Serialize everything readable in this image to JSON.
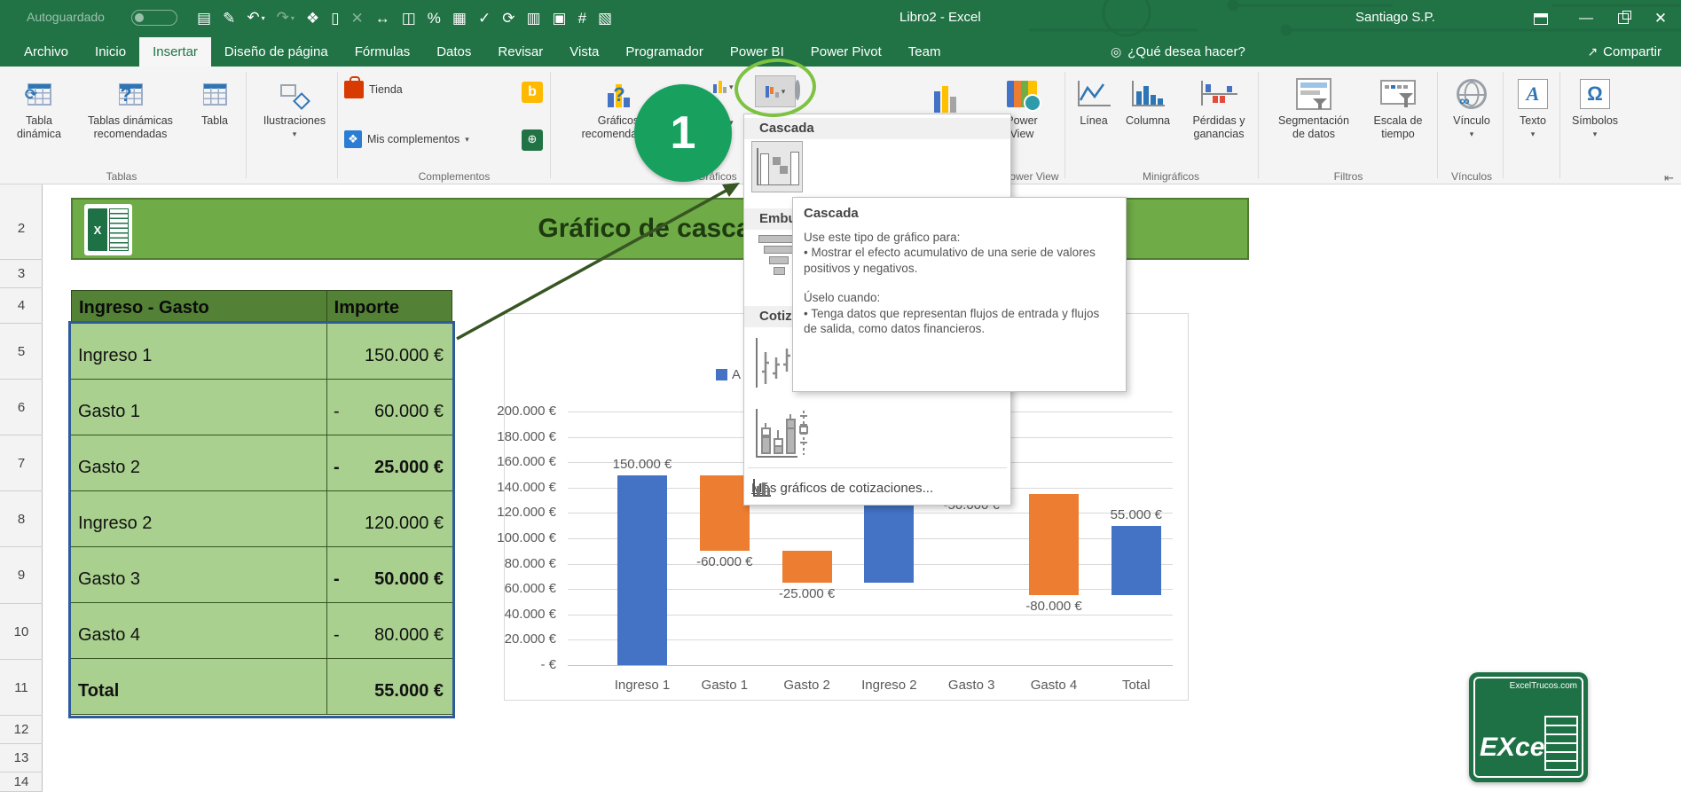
{
  "colors": {
    "excel_green": "#217346",
    "banner_green": "#6FAC47",
    "header_green": "#538135",
    "cell_green": "#A9D08E",
    "cell_border": "#375623",
    "selection_blue": "#2E5B9C",
    "bar_blue": "#4472C4",
    "bar_orange": "#ED7D31",
    "annotation_green": "#18A05E",
    "ring_green": "#7DC242",
    "arrow_green": "#375623"
  },
  "titlebar": {
    "autosave_label": "Autoguardado",
    "autosave_state": "off",
    "qat_icons": [
      {
        "glyph": "▤",
        "name": "new-file-icon"
      },
      {
        "glyph": "✎",
        "name": "save-icon"
      },
      {
        "glyph": "↶",
        "name": "undo-icon",
        "arrow": true
      },
      {
        "glyph": "↷",
        "name": "redo-icon",
        "arrow": true,
        "dim": true
      },
      {
        "glyph": "❖",
        "name": "format-painter-icon"
      },
      {
        "glyph": "▯",
        "name": "new-document-icon"
      },
      {
        "glyph": "✕",
        "name": "clear-filter-icon",
        "dim": true
      },
      {
        "glyph": "↔",
        "name": "resize-window-icon"
      },
      {
        "glyph": "◫",
        "name": "print-preview-icon"
      },
      {
        "glyph": "%",
        "name": "percent-style-icon"
      },
      {
        "glyph": "▦",
        "name": "print-icon"
      },
      {
        "glyph": "✓",
        "name": "spelling-icon"
      },
      {
        "glyph": "⟳",
        "name": "refresh-icon"
      },
      {
        "glyph": "▥",
        "name": "calculate-sheet-icon"
      },
      {
        "glyph": "▣",
        "name": "form-icon"
      },
      {
        "glyph": "#",
        "name": "number-format-icon"
      },
      {
        "glyph": "▧",
        "name": "paste-special-icon"
      }
    ],
    "document_title": "Libro2 - Excel",
    "user_name": "Santiago S.P."
  },
  "ribbon_tabs": {
    "items": [
      {
        "label": "Archivo",
        "name": "tab-archivo"
      },
      {
        "label": "Inicio",
        "name": "tab-inicio"
      },
      {
        "label": "Insertar",
        "name": "tab-insertar",
        "active": true
      },
      {
        "label": "Diseño de página",
        "name": "tab-diseno"
      },
      {
        "label": "Fórmulas",
        "name": "tab-formulas"
      },
      {
        "label": "Datos",
        "name": "tab-datos"
      },
      {
        "label": "Revisar",
        "name": "tab-revisar"
      },
      {
        "label": "Vista",
        "name": "tab-vista"
      },
      {
        "label": "Programador",
        "name": "tab-programador"
      },
      {
        "label": "Power BI",
        "name": "tab-power-bi"
      },
      {
        "label": "Power Pivot",
        "name": "tab-power-pivot"
      },
      {
        "label": "Team",
        "name": "tab-team"
      }
    ],
    "search_label": "¿Qué desea hacer?",
    "share_label": "Compartir"
  },
  "ribbon": {
    "tablas": {
      "group_label": "Tablas",
      "b1l1": "Tabla",
      "b1l2": "dinámica",
      "b2l1": "Tablas dinámicas",
      "b2l2": "recomendadas",
      "b3": "Tabla"
    },
    "ilustraciones": {
      "label": "Ilustraciones"
    },
    "complementos": {
      "group_label": "Complementos",
      "tienda": "Tienda",
      "mis": "Mis complementos"
    },
    "graficos": {
      "group_label": "Gráficos",
      "recl1": "Gráficos",
      "recl2": "recomendados"
    },
    "power_view": {
      "group_label": "Power View",
      "l1": "Power",
      "l2": "View"
    },
    "minigraficos": {
      "group_label": "Minigráficos",
      "linea": "Línea",
      "columna": "Columna",
      "perdidasl1": "Pérdidas y",
      "perdidasl2": "ganancias"
    },
    "filtros": {
      "group_label": "Filtros",
      "segl1": "Segmentación",
      "segl2": "de datos",
      "escl1": "Escala de",
      "escl2": "tiempo"
    },
    "vinculos": {
      "group_label": "Vínculos",
      "vinculo": "Vínculo"
    },
    "texto": {
      "label": "Texto"
    },
    "simbolos": {
      "label": "Símbolos"
    }
  },
  "dropdown_menu": {
    "sections": [
      {
        "header": "Cascada"
      },
      {
        "header": "Embudo"
      },
      {
        "header": "Cotizaciones"
      }
    ],
    "footer_accel": "M",
    "footer_rest": "ás gráficos de cotizaciones..."
  },
  "tooltip": {
    "title": "Cascada",
    "intro": "Use este tipo de gráfico para:",
    "bullet1": "• Mostrar el efecto acumulativo de una serie de valores positivos y negativos.",
    "when_title": "Úselo cuando:",
    "bullet2": "• Tenga datos que representan flujos de entrada y flujos de salida, como datos financieros."
  },
  "annotation": {
    "step_number": "1"
  },
  "sheet": {
    "row_numbers": [
      "2",
      "3",
      "4",
      "5",
      "6",
      "7",
      "8",
      "9",
      "10",
      "11",
      "12",
      "13",
      "14"
    ],
    "banner_title": "Gráfico de cascada",
    "table": {
      "header": [
        "Ingreso - Gasto",
        "Importe"
      ],
      "rows": [
        {
          "label": "Ingreso 1",
          "minus": "",
          "value": "150.000 €"
        },
        {
          "label": "Gasto 1",
          "minus": "-",
          "value": "60.000 €"
        },
        {
          "label": "Gasto 2",
          "minus": "-",
          "value": "25.000 €",
          "bold": true
        },
        {
          "label": "Ingreso 2",
          "minus": "",
          "value": "120.000 €"
        },
        {
          "label": "Gasto 3",
          "minus": "-",
          "value": "50.000 €",
          "bold": true
        },
        {
          "label": "Gasto 4",
          "minus": "-",
          "value": "80.000 €"
        },
        {
          "label": "Total",
          "minus": "",
          "value": "55.000 €",
          "bold": true,
          "label_bold": true
        }
      ]
    }
  },
  "chart_data": {
    "type": "bar",
    "subtype": "waterfall-built-from-stacked-columns",
    "legend": [
      "A"
    ],
    "legend_position": "top",
    "grid": true,
    "ylim": [
      0,
      200000
    ],
    "yticks": [
      {
        "label": "200.000 €",
        "value": 200000
      },
      {
        "label": "180.000 €",
        "value": 180000
      },
      {
        "label": "160.000 €",
        "value": 160000
      },
      {
        "label": "140.000 €",
        "value": 140000
      },
      {
        "label": "120.000 €",
        "value": 120000
      },
      {
        "label": "100.000 €",
        "value": 100000
      },
      {
        "label": "80.000 €",
        "value": 80000
      },
      {
        "label": "60.000 €",
        "value": 60000
      },
      {
        "label": "40.000 €",
        "value": 40000
      },
      {
        "label": "20.000 €",
        "value": 20000
      },
      {
        "label": "- €",
        "value": 0
      }
    ],
    "categories": [
      "Ingreso 1",
      "Gasto 1",
      "Gasto 2",
      "Ingreso 2",
      "Gasto 3",
      "Gasto 4",
      "Total"
    ],
    "bars": [
      {
        "category": "Ingreso 1",
        "value": 150000,
        "plot_from": 0,
        "plot_to": 150000,
        "color": "blue",
        "label": "150.000 €",
        "label_pos": "above"
      },
      {
        "category": "Gasto 1",
        "value": -60000,
        "plot_from": 90000,
        "plot_to": 150000,
        "color": "orange",
        "label": "-60.000 €",
        "label_pos": "below"
      },
      {
        "category": "Gasto 2",
        "value": -25000,
        "plot_from": 65000,
        "plot_to": 90000,
        "color": "orange",
        "label": "-25.000 €",
        "label_pos": "below"
      },
      {
        "category": "Ingreso 2",
        "value": 120000,
        "plot_from": 65000,
        "plot_to": 185000,
        "color": "blue",
        "label": "",
        "label_pos": "none"
      },
      {
        "category": "Gasto 3",
        "value": -50000,
        "plot_from": 135000,
        "plot_to": 185000,
        "color": "orange",
        "label": "-50.000 €",
        "label_pos": "below"
      },
      {
        "category": "Gasto 4",
        "value": -80000,
        "plot_from": 55000,
        "plot_to": 135000,
        "color": "orange",
        "label": "-80.000 €",
        "label_pos": "below"
      },
      {
        "category": "Total",
        "value": 55000,
        "plot_from": 55000,
        "plot_to": 110000,
        "color": "blue",
        "label": "55.000 €",
        "label_pos": "above"
      }
    ]
  },
  "logo_badge": {
    "site": "ExcelTrucos.com",
    "brand": "EXcel"
  }
}
